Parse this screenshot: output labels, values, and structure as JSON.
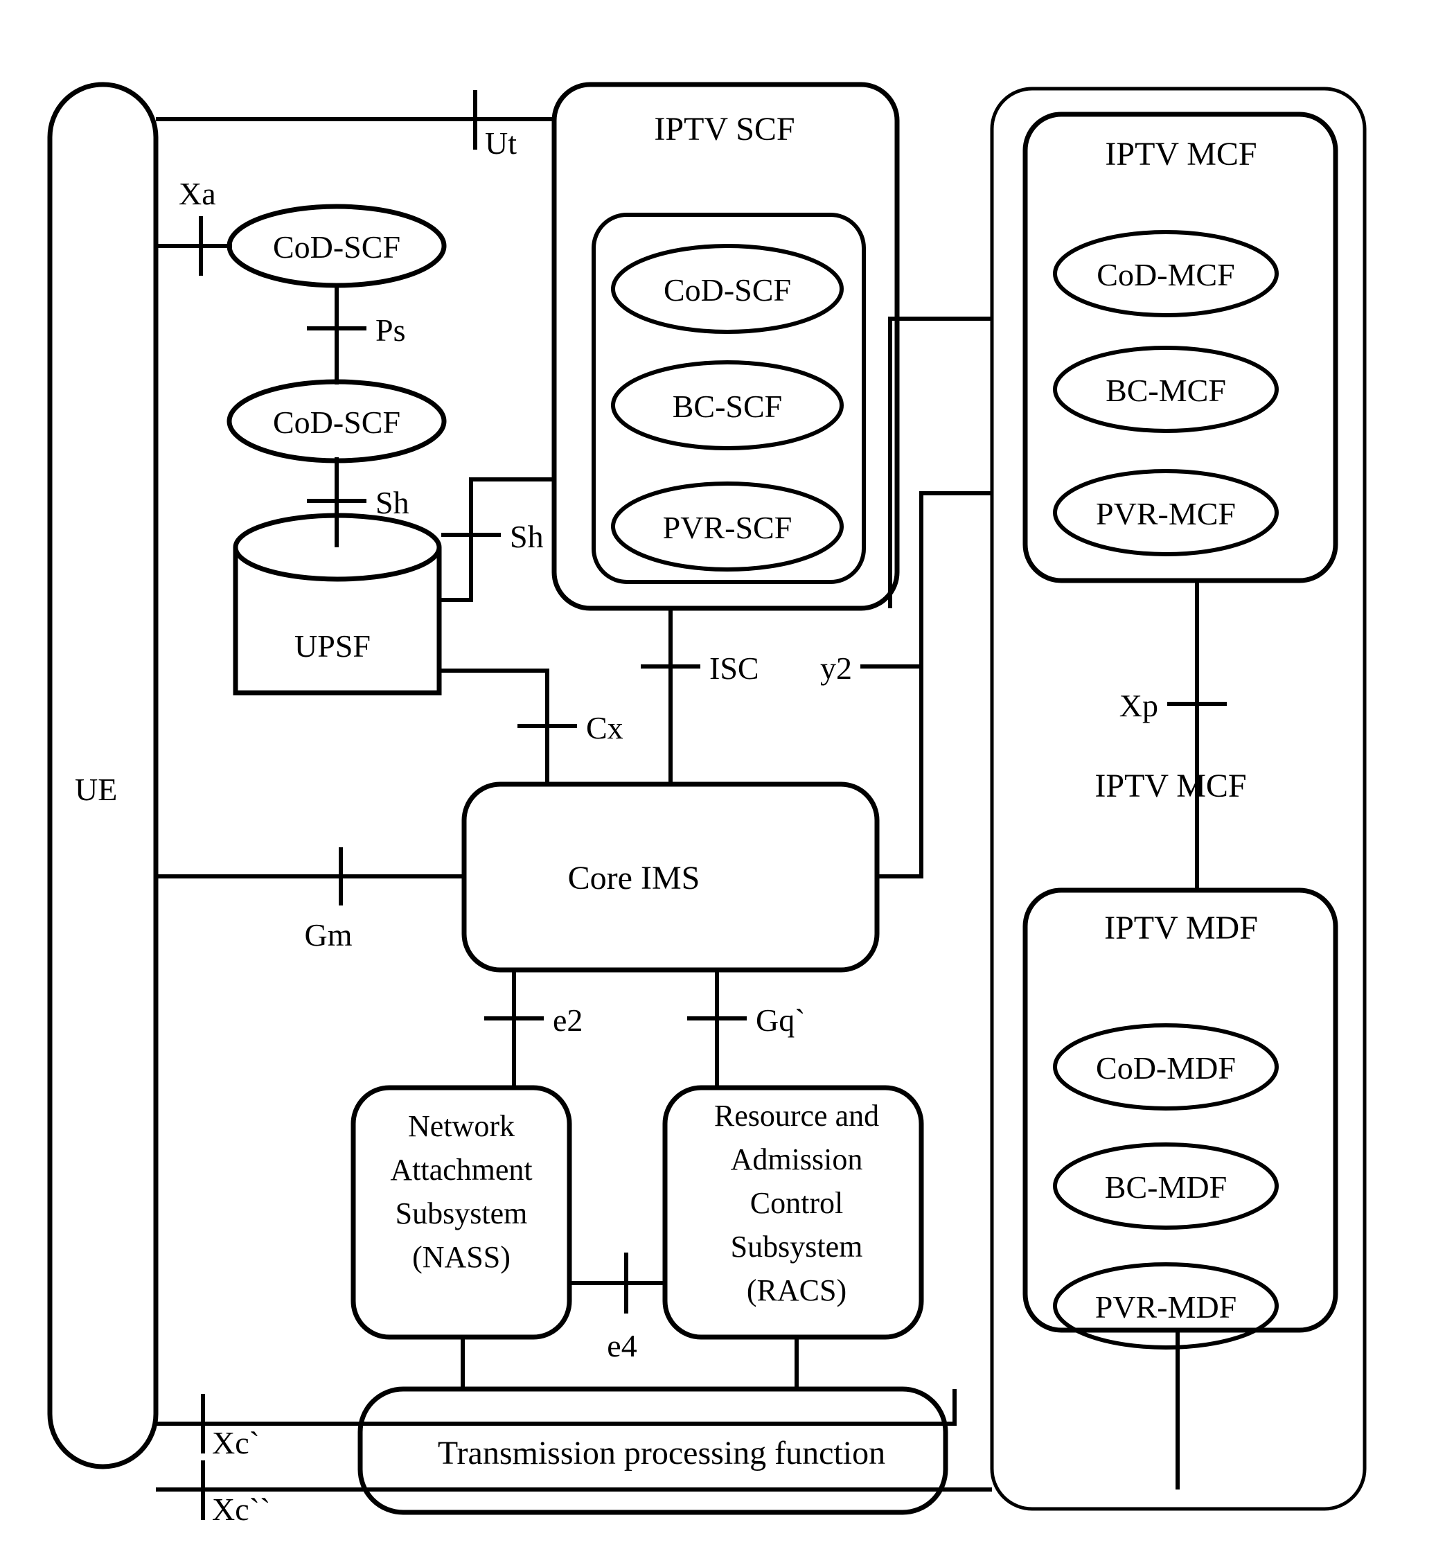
{
  "diagram": {
    "title": "IPTV IMS architecture reference diagram",
    "stroke_color": "#000000",
    "background_color": "#ffffff"
  },
  "nodes": {
    "ue": "UE",
    "cod_scf_outer_1": "CoD-SCF",
    "cod_scf_outer_2": "CoD-SCF",
    "upsf": "UPSF",
    "iptv_scf": "IPTV SCF",
    "scf_children": [
      "CoD-SCF",
      "BC-SCF",
      "PVR-SCF"
    ],
    "iptv_mcf": "IPTV MCF",
    "mcf_children": [
      "CoD-MCF",
      "BC-MCF",
      "PVR-MCF"
    ],
    "iptv_mcf_floating": "IPTV MCF",
    "iptv_mdf": "IPTV MDF",
    "mdf_children": [
      "CoD-MDF",
      "BC-MDF",
      "PVR-MDF"
    ],
    "core_ims": "Core IMS",
    "nass": "Network Attachment Subsystem (NASS)",
    "nass_lines": [
      "Network",
      "Attachment",
      "Subsystem",
      "(NASS)"
    ],
    "racs": "Resource and Admission Control Subsystem (RACS)",
    "racs_lines": [
      "Resource and",
      "Admission",
      "Control",
      "Subsystem",
      "(RACS)"
    ],
    "transmission": "Transmission processing function"
  },
  "reference_points": {
    "ut": "Ut",
    "xa": "Xa",
    "ps": "Ps",
    "sh_left": "Sh",
    "sh_right": "Sh",
    "isc": "ISC",
    "cx": "Cx",
    "y2": "y2",
    "xp": "Xp",
    "gm": "Gm",
    "e2": "e2",
    "gq": "Gq`",
    "e4": "e4",
    "xc1": "Xc`",
    "xc2": "Xc``"
  }
}
